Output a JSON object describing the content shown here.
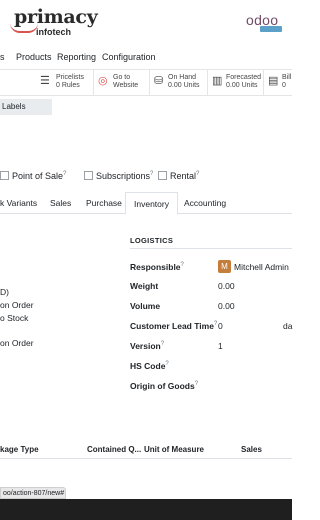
{
  "brand": {
    "logo": "primacy",
    "sub": "infotech",
    "product": "odoo"
  },
  "top_nav": [
    "s",
    "Products",
    "Reporting",
    "Configuration"
  ],
  "stat_buttons": [
    {
      "icon": "list-icon",
      "glyph": "☰",
      "line1": "Pricelists",
      "line2": "0 Rules"
    },
    {
      "icon": "globe-icon",
      "glyph": "◎",
      "line1": "Go to",
      "line2": "Website"
    },
    {
      "icon": "cubes-icon",
      "glyph": "⛁",
      "line1": "On Hand",
      "line2": "0.00 Units"
    },
    {
      "icon": "forecast-icon",
      "glyph": "▥",
      "line1": "Forecasted",
      "line2": "0.00 Units"
    },
    {
      "icon": "bill-icon",
      "glyph": "▤",
      "line1": "Bill",
      "line2": "0"
    }
  ],
  "labels_button": "Labels",
  "checks": [
    {
      "label": "Point of Sale",
      "help": "?"
    },
    {
      "label": "Subscriptions",
      "help": "?"
    },
    {
      "label": "Rental",
      "help": "?"
    }
  ],
  "tabs": [
    "k Variants",
    "Sales",
    "Purchase",
    "Inventory",
    "Accounting"
  ],
  "left_fragments": [
    "D)",
    "on Order",
    "o Stock",
    "on Order"
  ],
  "logistics": {
    "title": "LOGISTICS",
    "responsible_label": "Responsible",
    "responsible_avatar": "M",
    "responsible_value": "Mitchell Admin",
    "weight_label": "Weight",
    "weight_value": "0.00",
    "volume_label": "Volume",
    "volume_value": "0.00",
    "lead_time_label": "Customer Lead Time",
    "lead_time_value": "0",
    "lead_time_unit": "da",
    "version_label": "Version",
    "version_value": "1",
    "hs_code_label": "HS Code",
    "origin_label": "Origin of Goods",
    "help": "?"
  },
  "table_headers": [
    "kage Type",
    "Contained Q...",
    "Unit of Measure",
    "Sales"
  ],
  "status_url": "oo/action-807/new#"
}
